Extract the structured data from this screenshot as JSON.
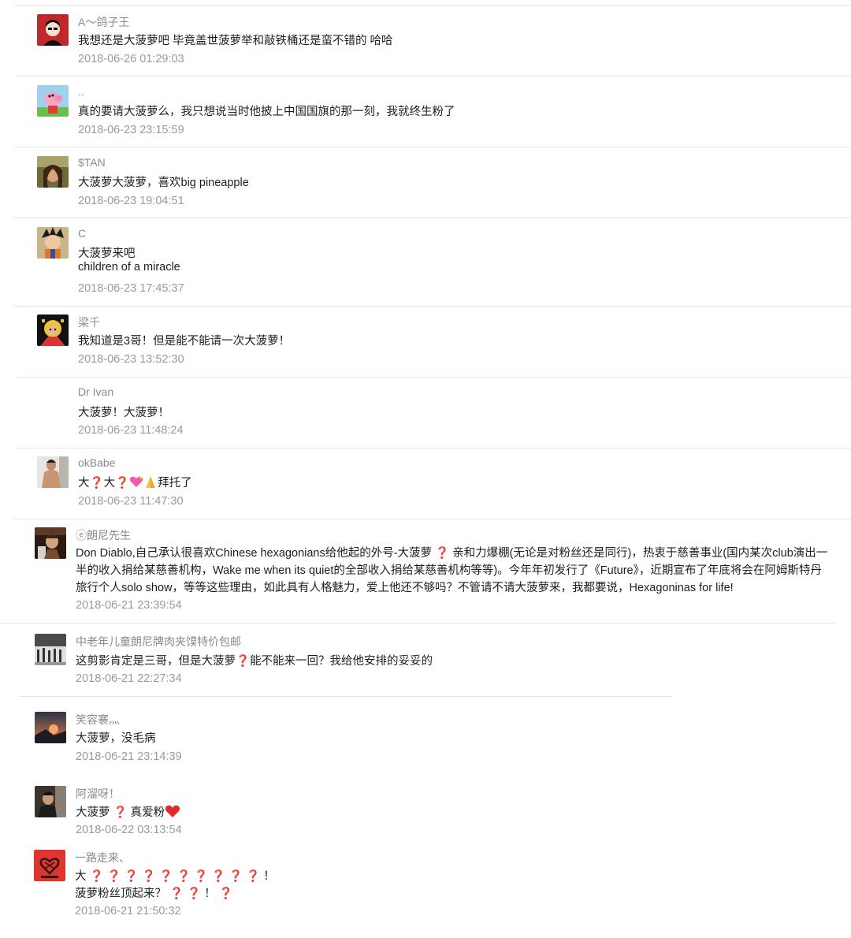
{
  "comments": [
    {
      "name": "A～鸽子王",
      "lines": [
        "我想还是大菠萝吧 毕竟盖世菠萝举和敲铁桶还是蛮不错的 哈哈"
      ],
      "time": "2018-06-26 01:29:03"
    },
    {
      "name": "..",
      "lines": [
        "真的要请大菠萝么，我只想说当时他披上中国国旗的那一刻，我就终生粉了"
      ],
      "time": "2018-06-23 23:15:59"
    },
    {
      "name": "$TAN",
      "lines": [
        "大菠萝大菠萝，喜欢big pineapple"
      ],
      "time": "2018-06-23 19:04:51"
    },
    {
      "name": "C",
      "lines": [
        "大菠萝来吧",
        "children of a miracle"
      ],
      "time": "2018-06-23 17:45:37"
    },
    {
      "name": "梁千",
      "lines": [
        "我知道是3哥！但是能不能请一次大菠萝！"
      ],
      "time": "2018-06-23 13:52:30"
    },
    {
      "name": "Dr Ivan",
      "lines": [
        "大菠萝！大菠萝！"
      ],
      "time": "2018-06-23 11:48:24"
    },
    {
      "name": "okBabe",
      "lines": [
        "大",
        "大",
        "拜托了"
      ],
      "time": "2018-06-23 11:47:30"
    },
    {
      "name": "ⓔ朗尼先生",
      "lines": [
        "Don Diablo,自己承认很喜欢Chinese hexagonians给他起的外号-大菠萝",
        "亲和力爆棚(无论是对粉丝还是同行)，热衷于慈善事业(国内某次club演出一",
        "半的收入捐给某慈善机构，Wake me when its quiet的全部收入捐给某慈善机构等等)。今年年初发行了《Future》，近期宣布了年底将会在阿姆斯特丹",
        "旅行个人solo show，等等这些理由，如此具有人格魅力，爱上他还不够吗？不管请不请大菠萝来，我都要说，Hexagoninas for life!"
      ],
      "time": "2018-06-21 23:39:54"
    },
    {
      "name": "中老年儿童朗尼牌肉夹馍特价包邮",
      "lines": [
        "这剪影肯定是三哥，但是大菠萝",
        "能不能来一回？我给他安排的妥妥的"
      ],
      "time": "2018-06-21 22:27:34"
    },
    {
      "name": "笑容褰灬",
      "lines": [
        "大菠萝，没毛病"
      ],
      "time": "2018-06-21 23:14:39"
    },
    {
      "name": "阿溜呀！",
      "lines": [
        "大菠萝",
        "真爱粉"
      ],
      "time": "2018-06-22 03:13:54"
    },
    {
      "name": "一路走来、",
      "lines": [
        "大",
        "！",
        "菠萝粉丝顶起来？",
        "！"
      ],
      "time": "2018-06-21 21:50:32"
    }
  ],
  "icons": {
    "question": "red-question-mark-icon",
    "heart": "sparkling-heart-icon",
    "pray": "folded-hands-icon",
    "red_heart": "red-heart-icon"
  },
  "colors": {
    "name": "#8a8a8a",
    "time": "#9a9a9a",
    "text": "#1e1e1e",
    "divider": "#e6e6e6",
    "emoji_red": "#d42525"
  }
}
